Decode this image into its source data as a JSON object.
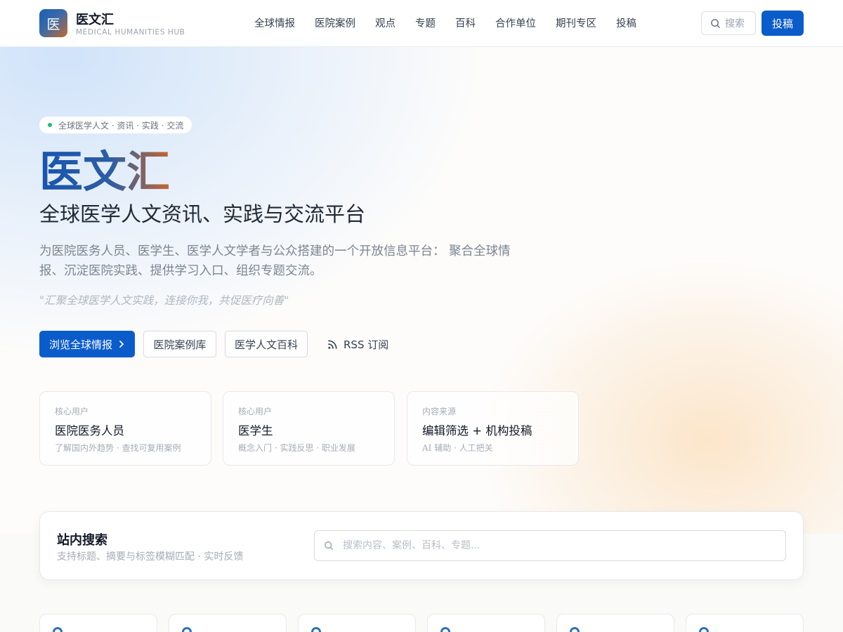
{
  "header": {
    "logo_char": "医",
    "brand_name": "医文汇",
    "brand_sub": "MEDICAL HUMANITIES HUB",
    "nav": [
      "全球情报",
      "医院案例",
      "观点",
      "专题",
      "百科",
      "合作单位",
      "期刊专区",
      "投稿"
    ],
    "search_label": "搜索",
    "submit_label": "投稿"
  },
  "hero": {
    "pill": "全球医学人文 · 资讯 · 实践 · 交流",
    "title": "医文汇",
    "subtitle": "全球医学人文资讯、实践与交流平台",
    "description": "为医院医务人员、医学生、医学人文学者与公众搭建的一个开放信息平台： 聚合全球情报、沉淀医院实践、提供学习入口、组织专题交流。",
    "quote": "\"汇聚全球医学人文实践，连接你我，共促医疗向善\"",
    "buttons": {
      "primary": "浏览全球情报",
      "cases": "医院案例库",
      "encyclopedia": "医学人文百科",
      "rss": "RSS 订阅"
    },
    "stats": [
      {
        "kicker": "核心用户",
        "title": "医院医务人员",
        "desc": "了解国内外趋势 · 查找可复用案例"
      },
      {
        "kicker": "核心用户",
        "title": "医学生",
        "desc": "概念入门 · 实践反思 · 职业发展"
      },
      {
        "kicker": "内容来源",
        "title": "编辑筛选 + 机构投稿",
        "desc": "AI 辅助 · 人工把关"
      }
    ]
  },
  "site_search": {
    "title": "站内搜索",
    "subtitle": "支持标题、摘要与标签模糊匹配 · 实时反馈",
    "placeholder": "搜索内容、案例、百科、专题...",
    "value": ""
  },
  "colors": {
    "accent": "#0b5ccb",
    "status_dot": "#22b87a"
  }
}
